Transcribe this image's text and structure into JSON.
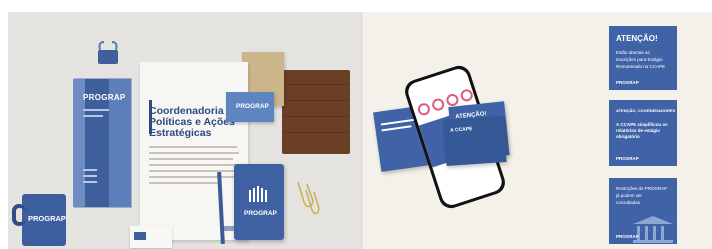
{
  "left_mockup": {
    "letter_title": "Coordenadoria de Políticas e Ações Estratégicas",
    "brand": "PROGRAP",
    "brochure_brand": "PROGRAP",
    "mug_brand": "PROGRAP",
    "notebook_brand": "PROGRAP",
    "card_brand": "PROGRAP"
  },
  "right_mockup": {
    "post_1_title": "ATENÇÃO!",
    "post_2_title": "A CCAPE",
    "stack_1_title": "ATENÇÃO!",
    "stack_1_lines": [
      "Estão abertas as",
      "inscrições para Estágio",
      "Remunerado na CCAPE"
    ],
    "stack_2_heading": "ATENÇÃO, COORDENADORES",
    "stack_2_body": "A CCAPE simplificou os relatórios de estágio obrigatório",
    "stack_3_lines": [
      "Restrições do PROGRAP",
      "já podem ser",
      "consultadas"
    ],
    "brand": "PROGRAP"
  },
  "colors": {
    "brand_blue": "#3f63a6",
    "left_bg": "#e4e3df",
    "right_bg": "#f4f0ea"
  }
}
